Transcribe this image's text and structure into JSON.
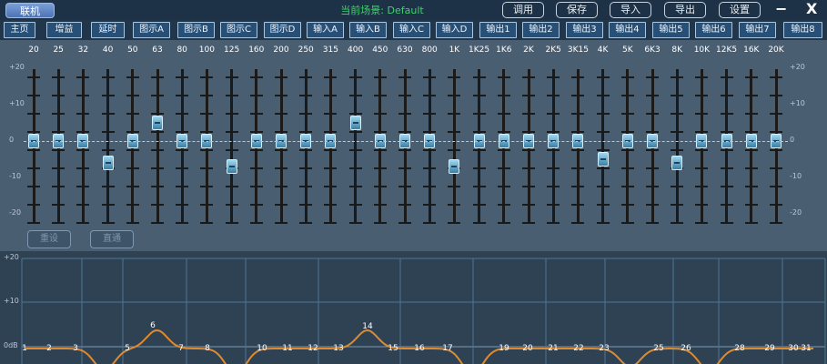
{
  "titlebar": {
    "link_label": "联机",
    "scene_label": "当前场景: Default",
    "buttons": [
      "调用",
      "保存",
      "导入",
      "导出",
      "设置"
    ],
    "minimize": "−",
    "close": "X"
  },
  "tabs": [
    "主页",
    "增益",
    "延时",
    "图示A",
    "图示B",
    "图示C",
    "图示D",
    "输入A",
    "输入B",
    "输入C",
    "输入D",
    "输出1",
    "输出2",
    "输出3",
    "输出4",
    "输出5",
    "输出6",
    "输出7",
    "输出8"
  ],
  "eq": {
    "frequencies": [
      "20",
      "25",
      "32",
      "40",
      "50",
      "63",
      "80",
      "100",
      "125",
      "160",
      "200",
      "250",
      "315",
      "400",
      "450",
      "630",
      "800",
      "1K",
      "1K25",
      "1K6",
      "2K",
      "2K5",
      "3K15",
      "4K",
      "5K",
      "6K3",
      "8K",
      "10K",
      "12K5",
      "16K",
      "20K"
    ],
    "gains_db": [
      0,
      0,
      0,
      -6,
      0,
      5,
      0,
      0,
      -7,
      0,
      0,
      0,
      0,
      5,
      0,
      0,
      0,
      -7,
      0,
      0,
      0,
      0,
      0,
      -5,
      0,
      0,
      -6,
      0,
      0,
      0,
      0
    ],
    "scale_labels": [
      "+20",
      "+10",
      "0",
      "-10",
      "-20"
    ],
    "reset_label": "重设",
    "bypass_label": "直通"
  },
  "graph": {
    "scale_labels": [
      "+20",
      "+10",
      "0dB"
    ],
    "band_numbers": [
      "1",
      "2",
      "3",
      "5",
      "6",
      "7",
      "8",
      "10",
      "11",
      "12",
      "13",
      "14",
      "15",
      "16",
      "17",
      "19",
      "20",
      "21",
      "22",
      "23",
      "25",
      "26",
      "28",
      "29",
      "30",
      "31"
    ]
  },
  "colors": {
    "accent": "#3fd06a",
    "curve": "#e08a2e",
    "knob": "#6cb7dc",
    "zero_line": "#d8d83a"
  }
}
